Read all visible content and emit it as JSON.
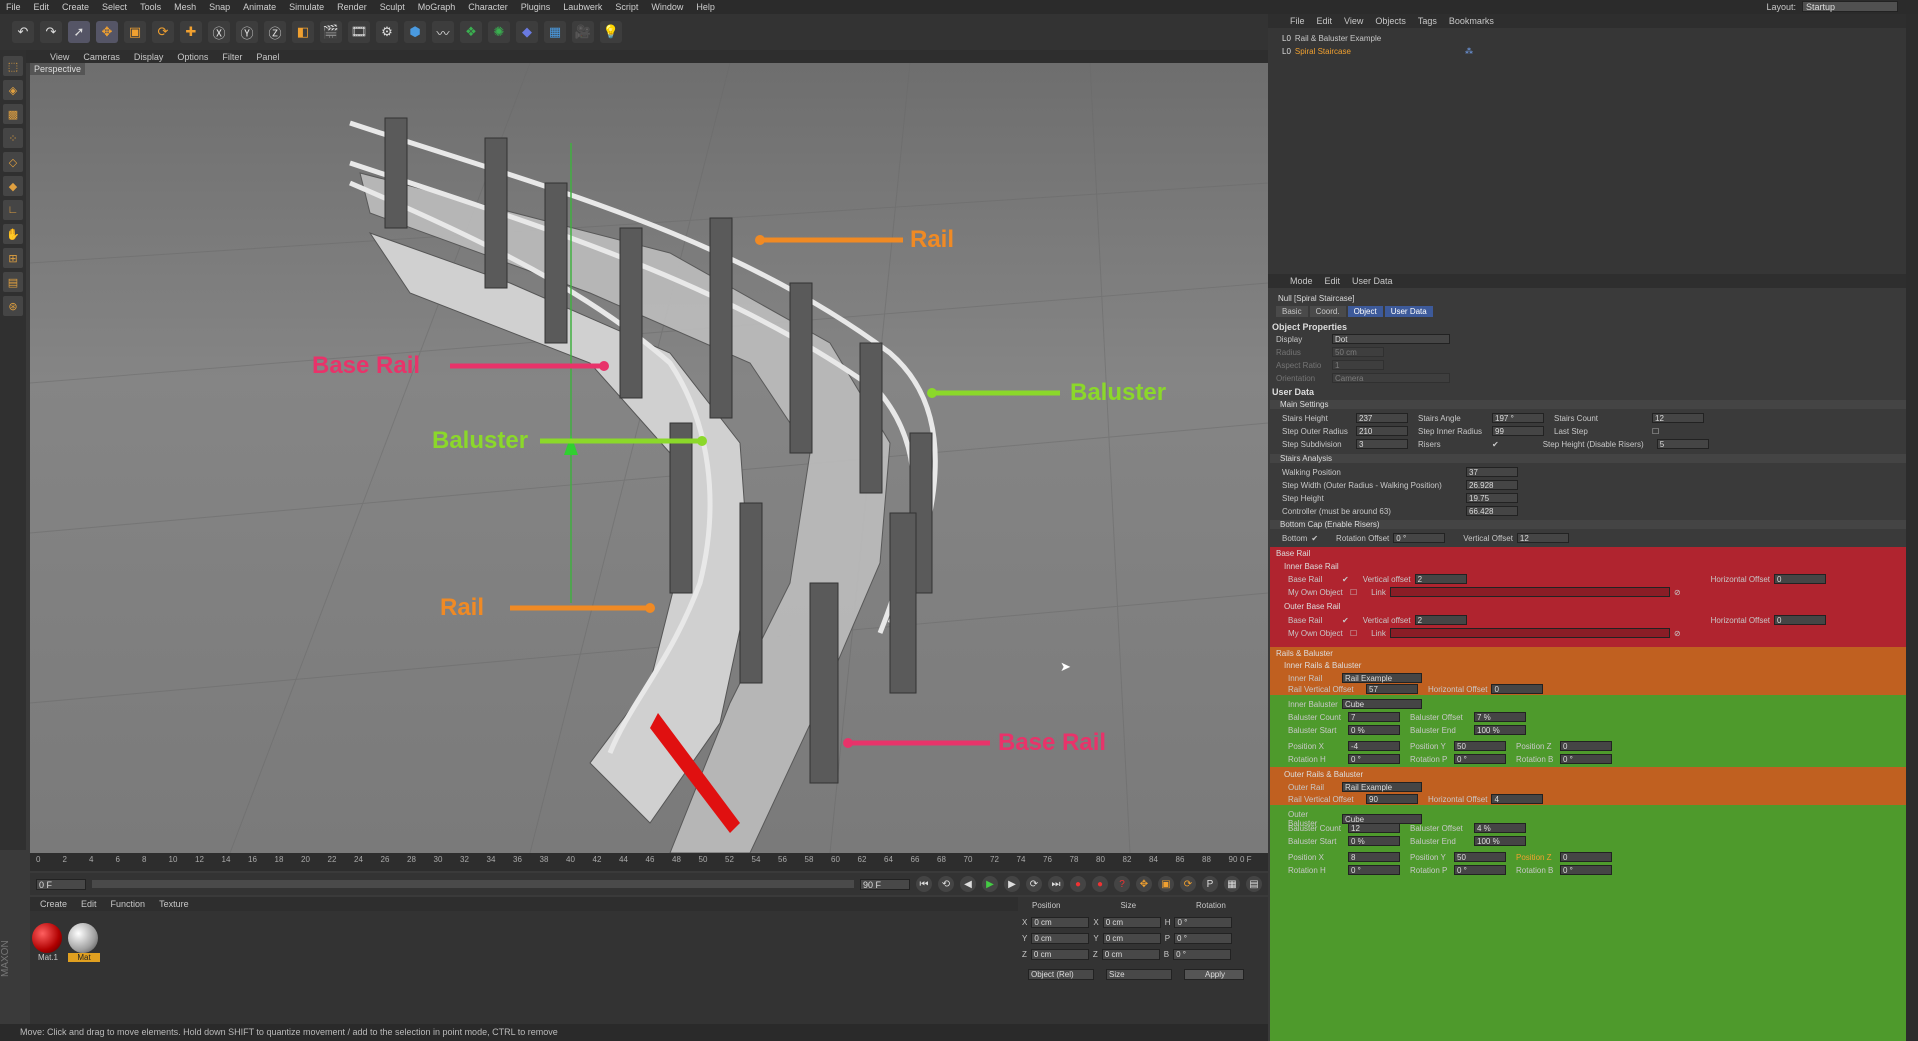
{
  "menubar": {
    "items": [
      "File",
      "Edit",
      "Create",
      "Select",
      "Tools",
      "Mesh",
      "Snap",
      "Animate",
      "Simulate",
      "Render",
      "Sculpt",
      "MoGraph",
      "Character",
      "Plugins",
      "Laubwerk",
      "Script",
      "Window",
      "Help"
    ],
    "layout_label": "Layout:",
    "layout_value": "Startup"
  },
  "viewport": {
    "menu": [
      "View",
      "Cameras",
      "Display",
      "Options",
      "Filter",
      "Panel"
    ],
    "label": "Perspective",
    "callouts": {
      "rail_top": "Rail",
      "base_rail_left": "Base Rail",
      "baluster_right": "Baluster",
      "baluster_left": "Baluster",
      "rail_bottom": "Rail",
      "base_rail_bottom": "Base Rail"
    }
  },
  "timeline": {
    "ticks": [
      "0",
      "2",
      "4",
      "6",
      "8",
      "10",
      "12",
      "14",
      "16",
      "18",
      "20",
      "22",
      "24",
      "26",
      "28",
      "30",
      "32",
      "34",
      "36",
      "38",
      "40",
      "42",
      "44",
      "46",
      "48",
      "50",
      "52",
      "54",
      "56",
      "58",
      "60",
      "62",
      "64",
      "66",
      "68",
      "70",
      "72",
      "74",
      "76",
      "78",
      "80",
      "82",
      "84",
      "86",
      "88",
      "90"
    ],
    "frame_end_marker": "0 F",
    "current": "0 F",
    "end": "90 F"
  },
  "materials": {
    "menu": [
      "Create",
      "Edit",
      "Function",
      "Texture"
    ],
    "items": [
      {
        "name": "Mat.1"
      },
      {
        "name": "Mat"
      }
    ]
  },
  "coords": {
    "headers": {
      "position": "Position",
      "size": "Size",
      "rotation": "Rotation"
    },
    "rows": [
      {
        "axis": "X",
        "pos": "0 cm",
        "saxis": "X",
        "size": "0 cm",
        "raxis": "H",
        "rot": "0 °"
      },
      {
        "axis": "Y",
        "pos": "0 cm",
        "saxis": "Y",
        "size": "0 cm",
        "raxis": "P",
        "rot": "0 °"
      },
      {
        "axis": "Z",
        "pos": "0 cm",
        "saxis": "Z",
        "size": "0 cm",
        "raxis": "B",
        "rot": "0 °"
      }
    ],
    "mode": "Object (Rel)",
    "size_mode": "Size",
    "apply": "Apply"
  },
  "status": "Move: Click and drag to move elements. Hold down SHIFT to quantize movement / add to the selection in point mode, CTRL to remove",
  "objmanager": {
    "menu": [
      "File",
      "Edit",
      "View",
      "Objects",
      "Tags",
      "Bookmarks"
    ],
    "objects": [
      "Rail & Baluster Example",
      "Spiral Staircase"
    ]
  },
  "attrs": {
    "menu": [
      "Mode",
      "Edit",
      "User Data"
    ],
    "title": "Null [Spiral Staircase]",
    "tabs": [
      "Basic",
      "Coord.",
      "Object",
      "User Data"
    ],
    "object_properties": "Object Properties",
    "display_label": "Display",
    "display_value": "Dot",
    "radius_label": "Radius",
    "radius_value": "50 cm",
    "aspect_label": "Aspect Ratio",
    "aspect_value": "1",
    "orientation_label": "Orientation",
    "orientation_value": "Camera",
    "user_data": "User Data",
    "main_settings": "Main Settings",
    "ms": {
      "stairs_height": "Stairs Height",
      "stairs_height_v": "237",
      "stairs_angle": "Stairs Angle",
      "stairs_angle_v": "197 °",
      "stairs_count": "Stairs Count",
      "stairs_count_v": "12",
      "step_outer": "Step Outer Radius",
      "step_outer_v": "210",
      "step_inner": "Step Inner Radius",
      "step_inner_v": "99",
      "last_step": "Last Step",
      "step_sub": "Step Subdivision",
      "step_sub_v": "3",
      "risers": "Risers",
      "step_height_dr": "Step Height (Disable Risers)",
      "step_height_dr_v": "5"
    },
    "analysis": "Stairs Analysis",
    "an": {
      "walking": "Walking Position",
      "walking_v": "37",
      "width": "Step Width (Outer Radius - Walking Position)",
      "width_v": "26.928",
      "step_height": "Step Height",
      "step_height_v": "19.75",
      "controller": "Controller (must be around 63)",
      "controller_v": "66.428"
    },
    "bottom_cap": "Bottom Cap (Enable Risers)",
    "bc": {
      "bottom": "Bottom",
      "rot_offset": "Rotation Offset",
      "rot_offset_v": "0 °",
      "vert_offset": "Vertical Offset",
      "vert_offset_v": "12"
    },
    "base_rail": "Base Rail",
    "inner_base_rail": "Inner Base Rail",
    "outer_base_rail": "Outer Base Rail",
    "br": {
      "base_rail": "Base Rail",
      "vertical_offset": "Vertical offset",
      "vertical_offset_v": "2",
      "horizontal_offset": "Horizontal Offset",
      "horizontal_offset_v": "0",
      "my_own_object": "My Own Object",
      "link": "Link"
    },
    "rails_baluster": "Rails & Baluster",
    "inner_rails": "Inner Rails & Baluster",
    "outer_rails": "Outer Rails & Baluster",
    "rb": {
      "inner_rail": "Inner Rail",
      "outer_rail": "Outer Rail",
      "rail_example": "Rail Example",
      "rail_vert_offset": "Rail Vertical Offset",
      "inner_rail_vert_v": "57",
      "outer_rail_vert_v": "90",
      "horiz_offset": "Horizontal Offset",
      "inner_horiz_v": "0",
      "outer_horiz_v": "4",
      "inner_baluster": "Inner Baluster",
      "outer_baluster": "Outer Baluster",
      "cube": "Cube",
      "baluster_count": "Baluster Count",
      "inner_count_v": "7",
      "outer_count_v": "12",
      "baluster_offset": "Baluster Offset",
      "inner_offset_v": "7 %",
      "outer_offset_v": "4 %",
      "baluster_start": "Baluster Start",
      "start_v": "0 %",
      "baluster_end": "Baluster End",
      "end_v": "100 %",
      "pos_x": "Position X",
      "inner_pos_x_v": "-4",
      "outer_pos_x_v": "8",
      "pos_y": "Position Y",
      "pos_y_v": "50",
      "pos_z": "Position Z",
      "pos_z_v": "0",
      "rot_h": "Rotation H",
      "rot_p": "Rotation P",
      "rot_b": "Rotation B",
      "rot_v": "0 °"
    }
  },
  "colors": {
    "rail": "#f08a24",
    "base_rail": "#e8336a",
    "baluster": "#8bd82a"
  }
}
